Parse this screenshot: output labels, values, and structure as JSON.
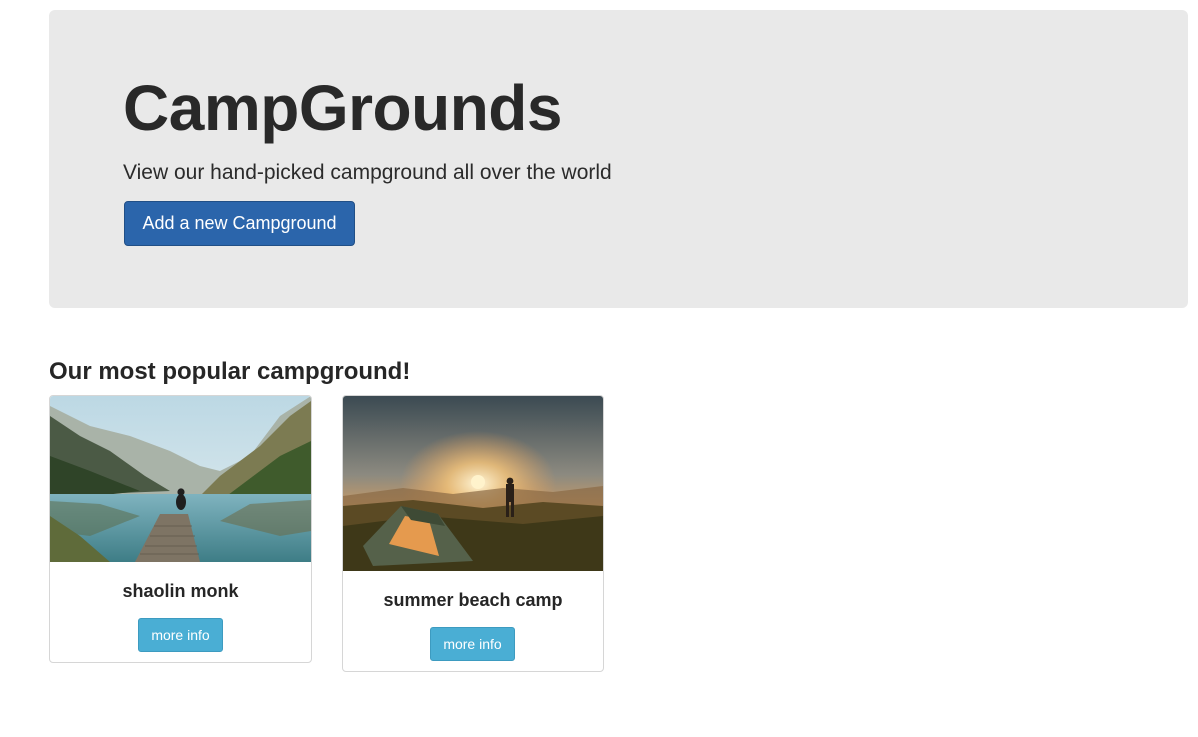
{
  "jumbotron": {
    "title": "CampGrounds",
    "subtitle": "View our hand-picked campground all over the world",
    "add_button_label": "Add a new Campground"
  },
  "section": {
    "heading": "Our most popular campground!"
  },
  "campgrounds": [
    {
      "name": "shaolin monk",
      "button_label": "more info",
      "image": "lake-dock-mountains-photo"
    },
    {
      "name": "summer beach camp",
      "button_label": "more info",
      "image": "tent-sunset-hiker-photo"
    }
  ],
  "colors": {
    "jumbotron_bg": "#e9e9e9",
    "primary_button": "#2b65ab",
    "info_button": "#4aaed4"
  }
}
